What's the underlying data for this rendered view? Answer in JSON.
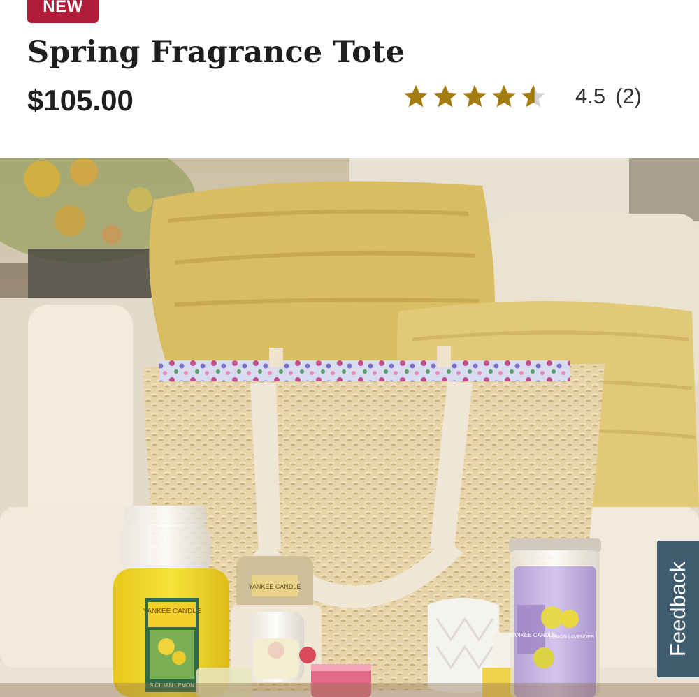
{
  "product": {
    "badge": "NEW",
    "title": "Spring Fragrance Tote",
    "price": "$105.00",
    "rating": {
      "value": "4.5",
      "count": "(2)",
      "stars_filled": 4.5,
      "stars_total": 5,
      "star_color": "#a37d10",
      "star_empty_color": "#d3d3d3"
    },
    "image": {
      "jar_label_brand": "YANKEE CANDLE",
      "jar_label_scent": "SICILIAN LEMON",
      "refill_label_brand": "YANKEE CANDLE",
      "tumbler_label_brand": "YANKEE CANDLE",
      "tumbler_label_scent": "LEMON LAVENDER"
    }
  },
  "feedback": {
    "label": "Feedback"
  },
  "colors": {
    "badge": "#b01c3a",
    "feedback_tab": "#3e5c6e",
    "text": "#1f1f1f"
  }
}
